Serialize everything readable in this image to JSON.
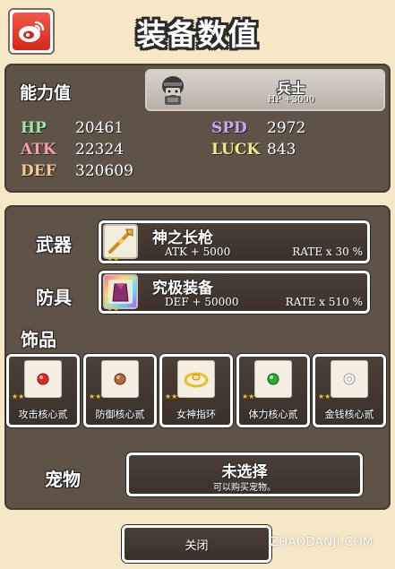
{
  "header": {
    "title": "装备数值",
    "share_icon": "weibo-icon"
  },
  "stats": {
    "section_label": "能力值",
    "character": {
      "name": "兵士",
      "sub": "HP +3000"
    },
    "items": [
      {
        "label": "HP",
        "value": "20461",
        "color": "#9fe8a4"
      },
      {
        "label": "ATK",
        "value": "22324",
        "color": "#f5a0a0"
      },
      {
        "label": "DEF",
        "value": "320609",
        "color": "#f5c79a"
      },
      {
        "label": "SPD",
        "value": "2972",
        "color": "#c8a8f0"
      },
      {
        "label": "LUCK",
        "value": "843",
        "color": "#f3ea87"
      }
    ]
  },
  "equipment": {
    "weapon": {
      "slot": "武器",
      "name": "神之长枪",
      "stat": "ATK + 5000",
      "rate": "RATE x 30 %"
    },
    "armor": {
      "slot": "防具",
      "name": "究极装备",
      "stat": "DEF + 50000",
      "rate": "RATE x 510 %"
    },
    "accessory_label": "饰品",
    "accessories": [
      {
        "label": "攻击核心贰",
        "gem_color": "#d92b2b"
      },
      {
        "label": "防御核心贰",
        "gem_color": "#b06a3a"
      },
      {
        "label": "女神指环",
        "gem_color": "#e8c020"
      },
      {
        "label": "体力核心贰",
        "gem_color": "#2aa83a"
      },
      {
        "label": "金钱核心贰",
        "gem_color": "#e8e8e8"
      }
    ]
  },
  "pet": {
    "slot": "宠物",
    "title": "未选择",
    "sub": "可以购买宠物。"
  },
  "footer": {
    "close_label": "关闭",
    "watermark": "ZHAODANJI.COM"
  }
}
